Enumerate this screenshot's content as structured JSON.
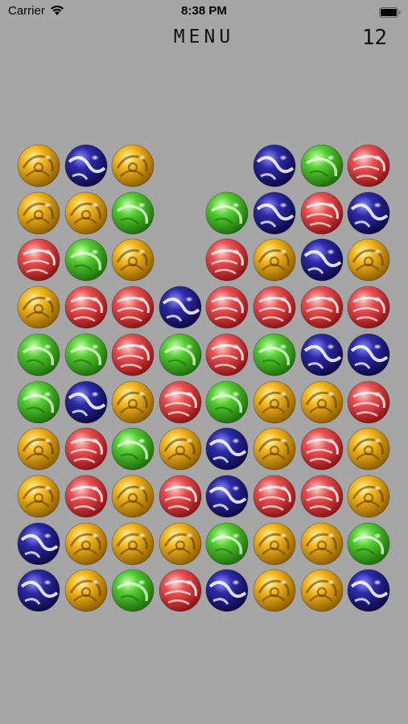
{
  "status_bar": {
    "carrier": "Carrier",
    "time": "8:38 PM"
  },
  "header": {
    "menu_label": "MENU",
    "score": "12"
  },
  "colors": {
    "background": "#a6a6a6",
    "yellow": "#f3b61d",
    "blue": "#2d2aa6",
    "green": "#54cc32",
    "red": "#ea5052"
  },
  "board": {
    "columns": 8,
    "rows": 10,
    "grid": [
      [
        "yellow",
        "blue",
        "yellow",
        null,
        null,
        "blue",
        "green",
        "red"
      ],
      [
        "yellow",
        "yellow",
        "green",
        null,
        "green",
        "blue",
        "red",
        "blue"
      ],
      [
        "red",
        "green",
        "yellow",
        null,
        "red",
        "yellow",
        "blue",
        "yellow"
      ],
      [
        "yellow",
        "red",
        "red",
        "blue",
        "red",
        "red",
        "red",
        "red"
      ],
      [
        "green",
        "green",
        "red",
        "green",
        "red",
        "green",
        "blue",
        "blue"
      ],
      [
        "green",
        "blue",
        "yellow",
        "red",
        "green",
        "yellow",
        "yellow",
        "red"
      ],
      [
        "yellow",
        "red",
        "green",
        "yellow",
        "blue",
        "yellow",
        "red",
        "yellow"
      ],
      [
        "yellow",
        "red",
        "yellow",
        "red",
        "blue",
        "red",
        "red",
        "yellow"
      ],
      [
        "blue",
        "yellow",
        "yellow",
        "yellow",
        "green",
        "yellow",
        "yellow",
        "green"
      ],
      [
        "blue",
        "yellow",
        "green",
        "red",
        "blue",
        "yellow",
        "yellow",
        "blue"
      ]
    ]
  }
}
